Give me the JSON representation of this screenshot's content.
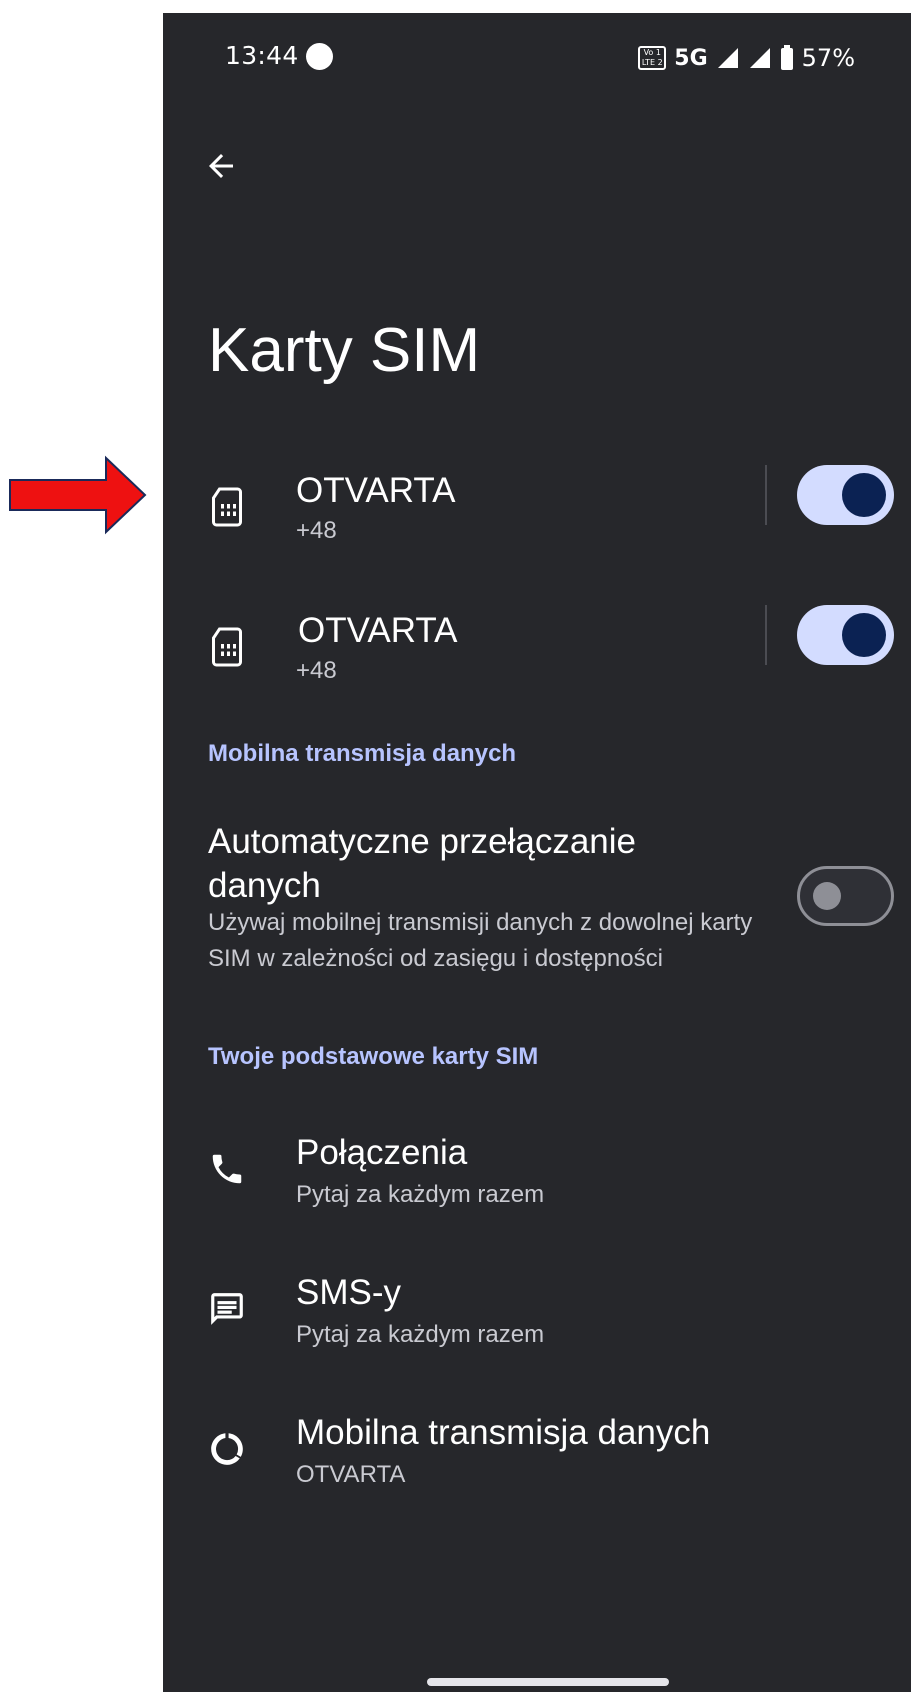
{
  "status_bar": {
    "time": "13:44",
    "volte_label_top": "Vo 1",
    "volte_label_bottom": "LTE 2",
    "network": "5G",
    "battery": "57%"
  },
  "page": {
    "title": "Karty SIM"
  },
  "sims": [
    {
      "name": "OTVARTA",
      "number": "+48",
      "enabled": true
    },
    {
      "name": "OTVARTA",
      "number": "+48",
      "enabled": true
    }
  ],
  "mobile_data_section": {
    "header": "Mobilna transmisja danych",
    "auto_switch": {
      "title": "Automatyczne przełączanie danych",
      "description": "Używaj mobilnej transmisji danych z dowolnej karty SIM w zależności od zasięgu i dostępności",
      "enabled": false
    }
  },
  "primary_section": {
    "header": "Twoje podstawowe karty SIM",
    "items": [
      {
        "title": "Połączenia",
        "subtitle": "Pytaj za każdym razem",
        "icon": "phone-icon"
      },
      {
        "title": "SMS-y",
        "subtitle": "Pytaj za każdym razem",
        "icon": "message-icon"
      },
      {
        "title": "Mobilna transmisja danych",
        "subtitle": "OTVARTA",
        "icon": "data-usage-icon"
      }
    ]
  },
  "colors": {
    "background": "#26272b",
    "accent": "#b7c4ff",
    "toggle_on_track": "#d3dcff",
    "toggle_on_knob": "#0b2253",
    "annotation_arrow": "#ee1111"
  }
}
